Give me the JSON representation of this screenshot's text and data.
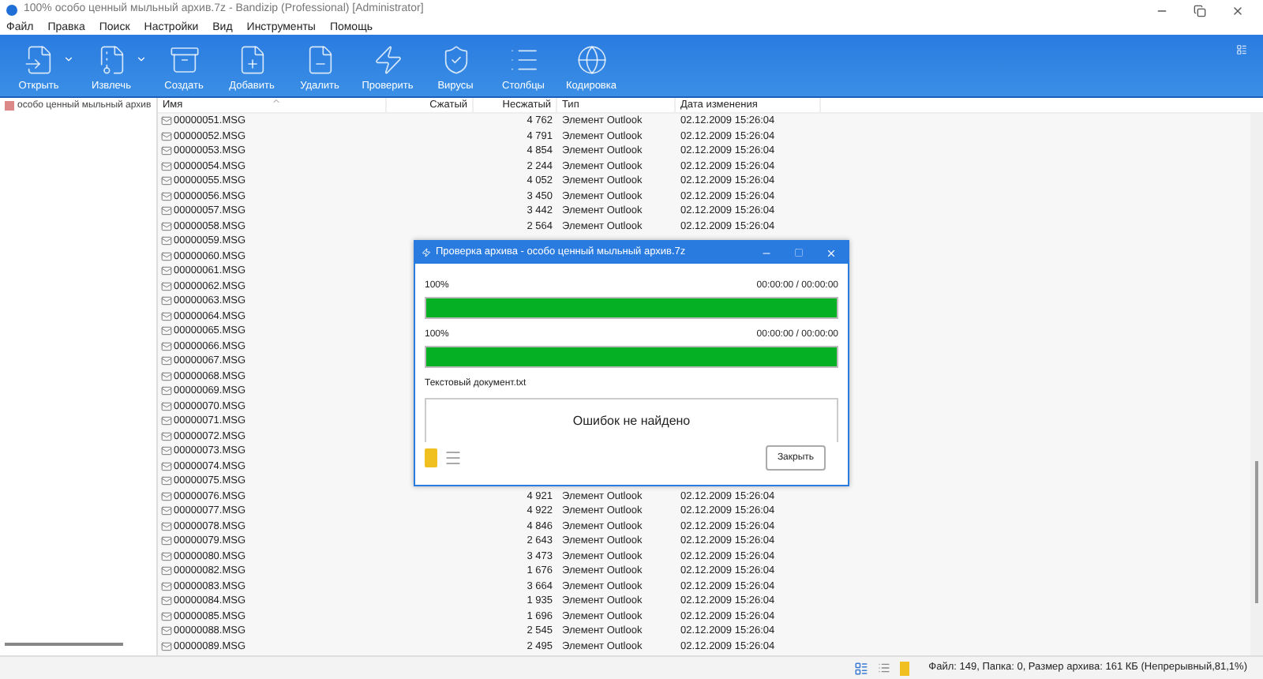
{
  "window": {
    "title": "100% особо ценный мыльный архив.7z - Bandizip (Professional) [Administrator]"
  },
  "menu": [
    "Файл",
    "Правка",
    "Поиск",
    "Настройки",
    "Вид",
    "Инструменты",
    "Помощь"
  ],
  "toolbar": [
    {
      "label": "Открыть",
      "kind": "open",
      "dropdown": true
    },
    {
      "label": "Извлечь",
      "kind": "extract",
      "dropdown": true
    },
    {
      "label": "Создать",
      "kind": "create",
      "dropdown": false
    },
    {
      "label": "Добавить",
      "kind": "add",
      "dropdown": false
    },
    {
      "label": "Удалить",
      "kind": "delete",
      "dropdown": false
    },
    {
      "label": "Проверить",
      "kind": "test",
      "dropdown": false
    },
    {
      "label": "Вирусы",
      "kind": "virus",
      "dropdown": false
    },
    {
      "label": "Столбцы",
      "kind": "columns",
      "dropdown": false
    },
    {
      "label": "Кодировка",
      "kind": "encoding",
      "dropdown": false
    }
  ],
  "tree": {
    "items": [
      {
        "label": "особо ценный мыльный архив",
        "selected": false
      }
    ]
  },
  "table": {
    "columns": [
      "Имя",
      "Сжатый",
      "Несжатый",
      "Тип",
      "Дата изменения"
    ],
    "rows": [
      {
        "name": "00000051.MSG",
        "size": "4 762",
        "type": "Элемент Outlook",
        "date": "02.12.2009 15:26:04"
      },
      {
        "name": "00000052.MSG",
        "size": "4 791",
        "type": "Элемент Outlook",
        "date": "02.12.2009 15:26:04"
      },
      {
        "name": "00000053.MSG",
        "size": "4 854",
        "type": "Элемент Outlook",
        "date": "02.12.2009 15:26:04"
      },
      {
        "name": "00000054.MSG",
        "size": "2 244",
        "type": "Элемент Outlook",
        "date": "02.12.2009 15:26:04"
      },
      {
        "name": "00000055.MSG",
        "size": "4 052",
        "type": "Элемент Outlook",
        "date": "02.12.2009 15:26:04"
      },
      {
        "name": "00000056.MSG",
        "size": "3 450",
        "type": "Элемент Outlook",
        "date": "02.12.2009 15:26:04"
      },
      {
        "name": "00000057.MSG",
        "size": "3 442",
        "type": "Элемент Outlook",
        "date": "02.12.2009 15:26:04"
      },
      {
        "name": "00000058.MSG",
        "size": "2 564",
        "type": "Элемент Outlook",
        "date": "02.12.2009 15:26:04"
      },
      {
        "name": "00000059.MSG"
      },
      {
        "name": "00000060.MSG"
      },
      {
        "name": "00000061.MSG"
      },
      {
        "name": "00000062.MSG"
      },
      {
        "name": "00000063.MSG"
      },
      {
        "name": "00000064.MSG"
      },
      {
        "name": "00000065.MSG"
      },
      {
        "name": "00000066.MSG"
      },
      {
        "name": "00000067.MSG"
      },
      {
        "name": "00000068.MSG"
      },
      {
        "name": "00000069.MSG"
      },
      {
        "name": "00000070.MSG"
      },
      {
        "name": "00000071.MSG"
      },
      {
        "name": "00000072.MSG"
      },
      {
        "name": "00000073.MSG"
      },
      {
        "name": "00000074.MSG"
      },
      {
        "name": "00000075.MSG"
      },
      {
        "name": "00000076.MSG",
        "size": "4 921",
        "type": "Элемент Outlook",
        "date": "02.12.2009 15:26:04"
      },
      {
        "name": "00000077.MSG",
        "size": "4 922",
        "type": "Элемент Outlook",
        "date": "02.12.2009 15:26:04"
      },
      {
        "name": "00000078.MSG",
        "size": "4 846",
        "type": "Элемент Outlook",
        "date": "02.12.2009 15:26:04"
      },
      {
        "name": "00000079.MSG",
        "size": "2 643",
        "type": "Элемент Outlook",
        "date": "02.12.2009 15:26:04"
      },
      {
        "name": "00000080.MSG",
        "size": "3 473",
        "type": "Элемент Outlook",
        "date": "02.12.2009 15:26:04"
      },
      {
        "name": "00000082.MSG",
        "size": "1 676",
        "type": "Элемент Outlook",
        "date": "02.12.2009 15:26:04"
      },
      {
        "name": "00000083.MSG",
        "size": "3 664",
        "type": "Элемент Outlook",
        "date": "02.12.2009 15:26:04"
      },
      {
        "name": "00000084.MSG",
        "size": "1 935",
        "type": "Элемент Outlook",
        "date": "02.12.2009 15:26:04"
      },
      {
        "name": "00000085.MSG",
        "size": "1 696",
        "type": "Элемент Outlook",
        "date": "02.12.2009 15:26:04"
      },
      {
        "name": "00000088.MSG",
        "size": "2 545",
        "type": "Элемент Outlook",
        "date": "02.12.2009 15:26:04"
      },
      {
        "name": "00000089.MSG",
        "size": "2 495",
        "type": "Элемент Outlook",
        "date": "02.12.2009 15:26:04"
      }
    ]
  },
  "dialog": {
    "title": "Проверка архива - особо ценный мыльный архив.7z",
    "progress": [
      {
        "percent": "100%",
        "time": "00:00:00 / 00:00:00",
        "level": 1
      },
      {
        "percent": "100%",
        "time": "00:00:00 / 00:00:00",
        "level": 1
      }
    ],
    "current_file": "Текстовый документ.txt",
    "message": "Ошибок не найдено",
    "close_button": "Закрыть"
  },
  "status_bar": {
    "text": "Файл: 149, Папка: 0, Размер архива: 161 КБ (Непрерывный,81,1%)"
  }
}
